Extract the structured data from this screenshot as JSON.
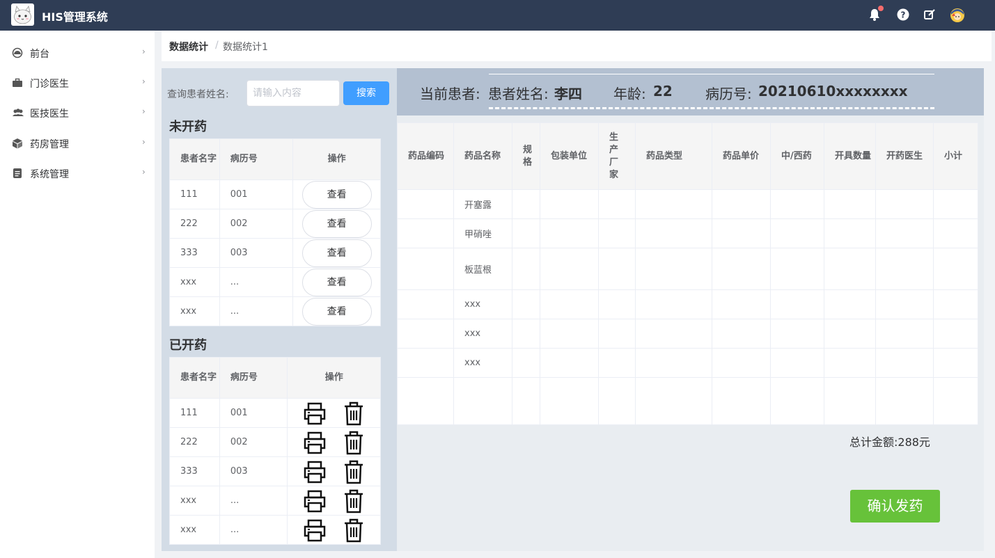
{
  "app": {
    "title": "HIS管理系统",
    "header_color": "#2f3d55"
  },
  "header_icons": [
    "bell-icon",
    "help-icon",
    "edit-icon",
    "user-avatar-icon"
  ],
  "sidebar": {
    "items": [
      {
        "label": "前台",
        "icon": "dashboard-icon"
      },
      {
        "label": "门诊医生",
        "icon": "briefcase-icon"
      },
      {
        "label": "医技医生",
        "icon": "users-icon"
      },
      {
        "label": "药房管理",
        "icon": "box-icon"
      },
      {
        "label": "系统管理",
        "icon": "document-icon"
      }
    ]
  },
  "breadcrumb": {
    "first": "数据统计",
    "separator": "/",
    "second": "数据统计1"
  },
  "search": {
    "label": "查询患者姓名:",
    "placeholder": "请输入内容",
    "button": "搜索"
  },
  "unprescribed": {
    "title": "未开药",
    "headers": [
      "患者名字",
      "病历号",
      "操作"
    ],
    "rows": [
      [
        "111",
        "001",
        "查看"
      ],
      [
        "222",
        "002",
        "查看"
      ],
      [
        "333",
        "003",
        "查看"
      ],
      [
        "xxx",
        "...",
        "查看"
      ],
      [
        "xxx",
        "...",
        "查看"
      ]
    ]
  },
  "prescribed": {
    "title": "已开药",
    "headers": [
      "患者名字",
      "病历号",
      "操作"
    ],
    "rows": [
      [
        "111",
        "001"
      ],
      [
        "222",
        "002"
      ],
      [
        "333",
        "003"
      ],
      [
        "xxx",
        "..."
      ],
      [
        "xxx",
        "..."
      ]
    ]
  },
  "patient": {
    "label": "当前患者:",
    "name_label": "患者姓名:",
    "name": "李四",
    "age_label": "年龄:",
    "age": "22",
    "record_label": "病历号:",
    "record": "20210610xxxxxxxx"
  },
  "drug_table": {
    "headers": [
      "药品编码",
      "药品名称",
      "规格",
      "包装单位",
      "生产厂家",
      "药品类型",
      "药品单价",
      "中/西药",
      "开具数量",
      "开药医生",
      "小计"
    ],
    "rows": [
      [
        "",
        "开塞露",
        "",
        "",
        "",
        "",
        "",
        "",
        "",
        "",
        ""
      ],
      [
        "",
        "甲硝唑",
        "",
        "",
        "",
        "",
        "",
        "",
        "",
        "",
        ""
      ],
      [
        "",
        "板蓝根",
        "",
        "",
        "",
        "",
        "",
        "",
        "",
        "",
        ""
      ],
      [
        "",
        "xxx",
        "",
        "",
        "",
        "",
        "",
        "",
        "",
        "",
        ""
      ],
      [
        "",
        "xxx",
        "",
        "",
        "",
        "",
        "",
        "",
        "",
        "",
        ""
      ],
      [
        "",
        "xxx",
        "",
        "",
        "",
        "",
        "",
        "",
        "",
        "",
        ""
      ],
      [
        "",
        "",
        "",
        "",
        "",
        "",
        "",
        "",
        "",
        "",
        ""
      ]
    ]
  },
  "total": {
    "text": "总计金额:288元"
  },
  "confirm": {
    "label": "确认发药",
    "color": "#67c23a"
  }
}
